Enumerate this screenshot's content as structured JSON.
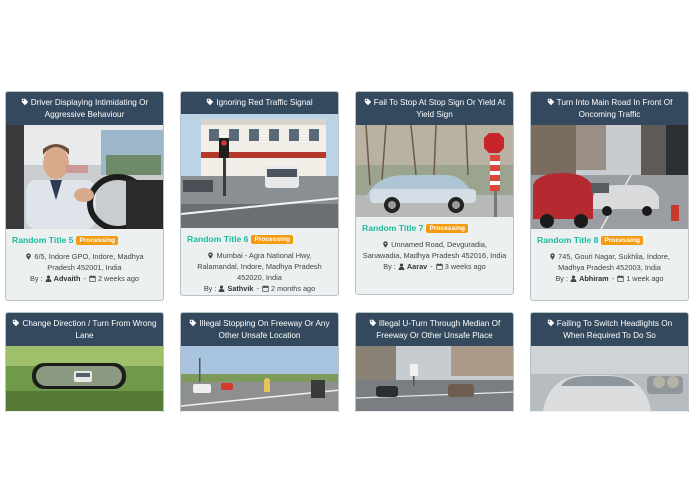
{
  "cards": [
    {
      "heading": "Driver Displaying Intimidating Or Aggressive Behaviour",
      "title": "Random Title 5",
      "status": "Processing",
      "address": "6/5, Indore GPO, Indore, Madhya Pradesh 452001, India",
      "by_label": "By :",
      "author": "Advaith",
      "time": "2 weeks ago",
      "image_icon": "driver-photo"
    },
    {
      "heading": "Ignoring Red Traffic Signal",
      "title": "Random Title 6",
      "status": "Processing",
      "address": "Mumbai - Agra National Hwy, Ralamandal, Indore, Madhya Pradesh 452020, India",
      "by_label": "By :",
      "author": "Sathvik",
      "time": "2 months ago",
      "image_icon": "traffic-signal-photo"
    },
    {
      "heading": "Fail To Stop At Stop Sign Or Yield At Yield Sign",
      "title": "Random Title 7",
      "status": "Processing",
      "address": "Unnamed Road, Devguradia, Sanawadia, Madhya Pradesh 452016, India",
      "by_label": "By :",
      "author": "Aarav",
      "time": "3 weeks ago",
      "image_icon": "stop-sign-photo"
    },
    {
      "heading": "Turn Into Main Road In Front Of Oncoming Traffic",
      "title": "Random Title 8",
      "status": "Processing",
      "address": "745, Gouri Nagar, Sukhlia, Indore, Madhya Pradesh 452003, India",
      "by_label": "By :",
      "author": "Abhiram",
      "time": "1 week ago",
      "image_icon": "street-traffic-photo"
    },
    {
      "heading": "Change Direction / Turn From Wrong Lane",
      "image_icon": "mirror-photo"
    },
    {
      "heading": "Illegal Stopping On Freeway Or Any Other Unsafe Location",
      "image_icon": "freeway-photo"
    },
    {
      "heading": "Illegal U-Turn Through Median Of Freeway Or Other Unsafe Place",
      "image_icon": "u-turn-photo"
    },
    {
      "heading": "Failing To Switch Headlights On When Required To Do So",
      "image_icon": "fog-car-photo"
    }
  ],
  "colors": {
    "header": "#34495e",
    "card_bg": "#ecf0f1",
    "title": "#1abc9c",
    "badge": "#f39c12"
  }
}
